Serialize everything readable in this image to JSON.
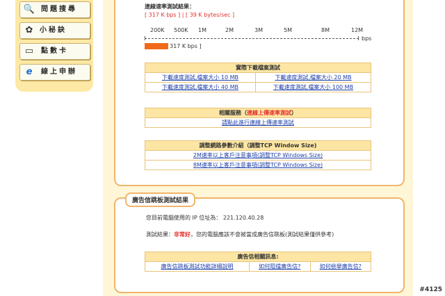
{
  "sidebar": {
    "items": [
      {
        "label": "問題搜尋",
        "icon": "magnifier-icon"
      },
      {
        "label": "小秘訣",
        "icon": "tips-icon"
      },
      {
        "label": "點數卡",
        "icon": "card-icon"
      },
      {
        "label": "線上申辦",
        "icon": "ie-browser-icon"
      }
    ]
  },
  "speed_test": {
    "result_title": "連線速率測試結果：",
    "result_value": "[ 317 K bps ] | [ 39 K bytes/sec ]",
    "scale_labels": [
      "200K",
      "500K",
      "1M",
      "2M",
      "3M",
      "5M",
      "8M",
      "12M"
    ],
    "scale_unit": "bps",
    "bar_label": "317 K bps ]",
    "bar_fill_fraction": 0.11
  },
  "download_table": {
    "header": "實際下載檔案測試",
    "links": [
      "下載速度測試,檔案大小 10 MB",
      "下載速度測試,檔案大小 20 MB",
      "下載速度測試,檔案大小 40 MB",
      "下載速度測試,檔案大小 100 MB"
    ]
  },
  "related_table": {
    "header_prefix": "相關服務（",
    "header_highlight": "連線上傳速率測試",
    "header_suffix": "）",
    "link": "請點此進行連線上傳速率測試"
  },
  "tcp_table": {
    "header": "調整網路參數介紹（調整TCP Window Size)",
    "links": [
      "2M速率以上客戶注意事項(調整TCP Windows Size)",
      "8M速率以上客戶注意事項(調整TCP Windows Size)"
    ]
  },
  "spam_panel": {
    "title": "廣告信跳板測試結果",
    "ip_label": "您目前電腦使用的 IP 位址為：",
    "ip_value": "221.120.40.28",
    "result_label": "測試結果：",
    "result_highlight": "非常好",
    "result_text": "，您的電腦應該不會被當成廣告信跳板(測試結果僅供參考)",
    "info_header": "廣告信相關訊息:",
    "links": [
      "廣告信跳板測試功能詳細說明",
      "如何阻擋廣告信?",
      "如何檢舉廣告信?"
    ]
  },
  "watermark": "#4125",
  "colors": {
    "panel_border": "#f0b56a",
    "header_bg": "#fde6a4",
    "accent_red": "#e2302b",
    "link": "#1f3fa8",
    "bar": "#f06a1a"
  }
}
